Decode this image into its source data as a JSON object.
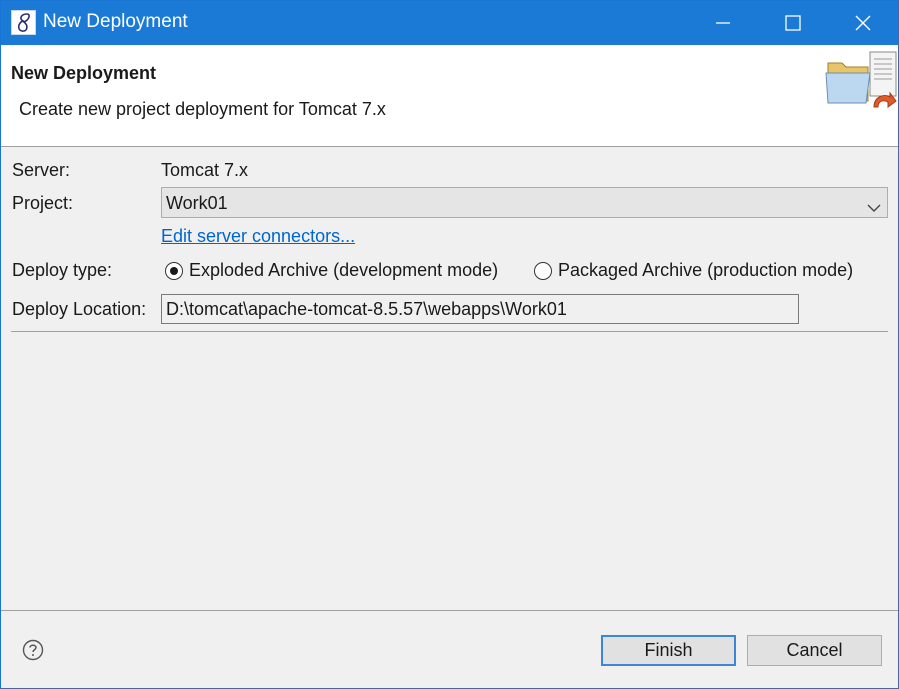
{
  "window": {
    "title": "New Deployment"
  },
  "banner": {
    "title": "New Deployment",
    "subtitle": "Create new project deployment for Tomcat  7.x",
    "icon": "deployment-wizard-icon"
  },
  "form": {
    "server_label": "Server:",
    "server_value": "Tomcat  7.x",
    "project_label": "Project:",
    "project_value": "Work01",
    "edit_connectors_link": "Edit server connectors...",
    "deploy_type_label": "Deploy type:",
    "deploy_options": [
      {
        "label": "Exploded Archive (development mode)",
        "checked": true
      },
      {
        "label": "Packaged Archive (production mode)",
        "checked": false
      }
    ],
    "location_label": "Deploy Location:",
    "location_value": "D:\\tomcat\\apache-tomcat-8.5.57\\webapps\\Work01"
  },
  "footer": {
    "finish_label": "Finish",
    "cancel_label": "Cancel"
  },
  "colors": {
    "titlebar": "#1a7ad6",
    "link": "#0066cc",
    "default_button_border": "#3c86d8"
  }
}
